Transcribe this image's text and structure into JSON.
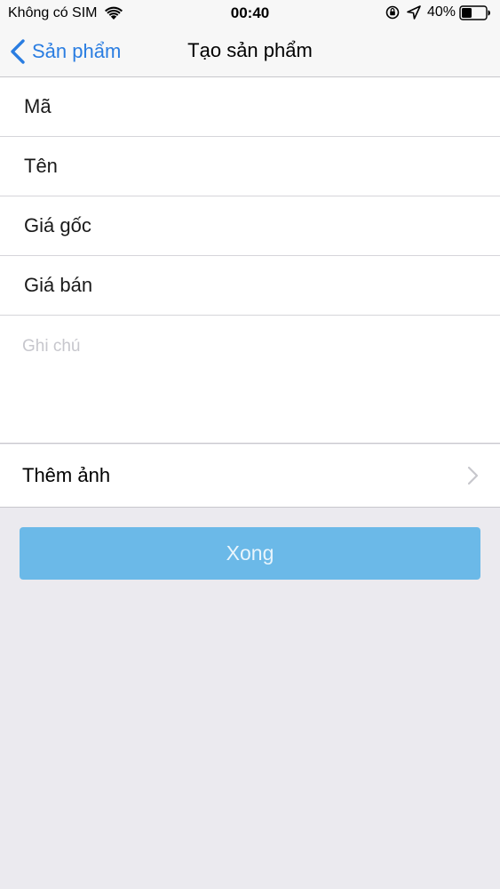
{
  "status_bar": {
    "carrier": "Không có SIM",
    "time": "00:40",
    "battery": "40%"
  },
  "nav": {
    "back_label": "Sản phẩm",
    "title": "Tạo sản phẩm"
  },
  "form": {
    "code_placeholder": "Mã",
    "name_placeholder": "Tên",
    "cost_price_placeholder": "Giá gốc",
    "sale_price_placeholder": "Giá bán",
    "note_placeholder": "Ghi chú",
    "add_photo_label": "Thêm ảnh"
  },
  "done_button": {
    "label": "Xong"
  },
  "colors": {
    "accent": "#2a7de1",
    "button": "#6bb9e8",
    "background": "#ebeaef"
  }
}
